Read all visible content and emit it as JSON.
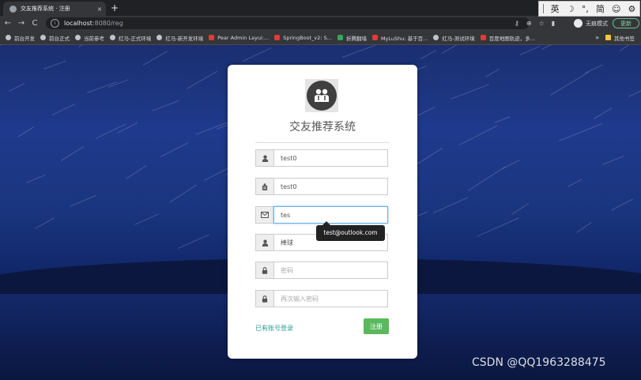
{
  "browser": {
    "tab_title": "交友推荐系统 · 注册",
    "tab_close": "×",
    "new_tab": "+",
    "url_host": "localhost",
    "url_path": ":8080/reg",
    "incognito_label": "无痕模式",
    "update_label": "更新",
    "ime": [
      "英",
      "简"
    ],
    "bookmarks": [
      {
        "label": "前台开发",
        "icon": "globe-icon"
      },
      {
        "label": "前台正式",
        "icon": "globe-icon"
      },
      {
        "label": "当前参考",
        "icon": "globe-icon"
      },
      {
        "label": "红马-正式环境",
        "icon": "globe-icon"
      },
      {
        "label": "红马-新开发环境",
        "icon": "globe-icon"
      },
      {
        "label": "Pear Admin Layui:...",
        "icon": "g-red-icon"
      },
      {
        "label": "SpringBoot_v2: S...",
        "icon": "g-red-icon"
      },
      {
        "label": "折腾翻墙",
        "icon": "green-icon"
      },
      {
        "label": "MyLuShu: 基于百...",
        "icon": "g-red-icon"
      },
      {
        "label": "红马-测试环境",
        "icon": "globe-icon"
      },
      {
        "label": "百度地图轨迹，多...",
        "icon": "g-red-icon"
      }
    ],
    "bookmarks_more": "»",
    "bookmarks_folder": "其他书签"
  },
  "form": {
    "title": "交友推荐系统",
    "username": {
      "value": "test0",
      "placeholder": ""
    },
    "nickname": {
      "value": "test0",
      "placeholder": ""
    },
    "email": {
      "value": "tes",
      "placeholder": ""
    },
    "email_suggestion": "test@outlook.com",
    "hobby": {
      "value": "棒球",
      "placeholder": ""
    },
    "password": {
      "value": "",
      "placeholder": "密码"
    },
    "confirm_password": {
      "value": "",
      "placeholder": "再次输入密码"
    },
    "login_link": "已有账号登录",
    "submit_label": "注册"
  },
  "watermark": "CSDN @QQ1963288475",
  "colors": {
    "submit": "#5cb85c",
    "link": "#2a9d8f",
    "focus": "#66afe9"
  }
}
